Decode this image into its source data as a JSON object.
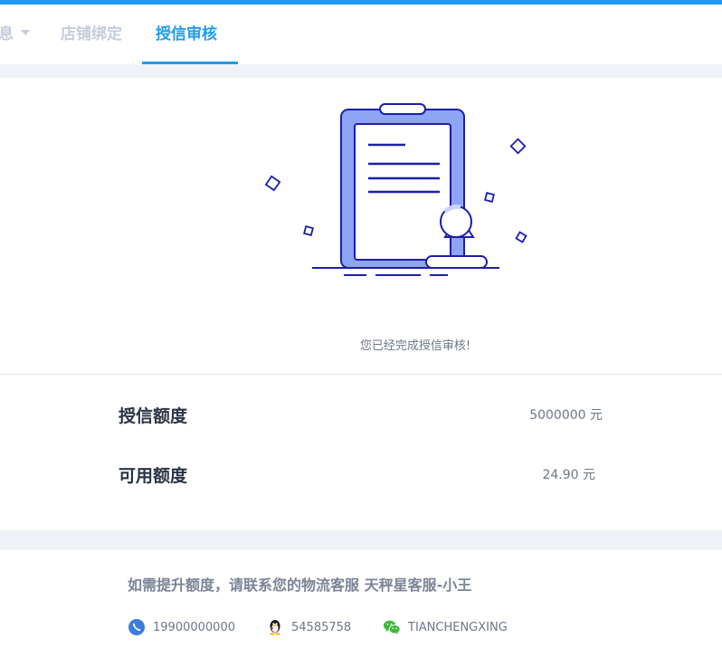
{
  "tabs": [
    {
      "label": "息",
      "has_caret": true,
      "active": false
    },
    {
      "label": "店铺绑定",
      "active": false
    },
    {
      "label": "授信审核",
      "active": true
    }
  ],
  "status": {
    "message": "您已经完成授信审核!"
  },
  "credit": {
    "rows": [
      {
        "label": "授信额度",
        "value": "5000000 元"
      },
      {
        "label": "可用额度",
        "value": "24.90 元"
      }
    ]
  },
  "contact": {
    "title": "如需提升额度，请联系您的物流客服 天秤星客服-小王",
    "phone": "19900000000",
    "qq": "54585758",
    "wechat": "TIANCHENGXING"
  },
  "colors": {
    "accent": "#1e9bf0",
    "illustration_fill": "#8ea4f5",
    "illustration_stroke": "#1b1fa8"
  }
}
